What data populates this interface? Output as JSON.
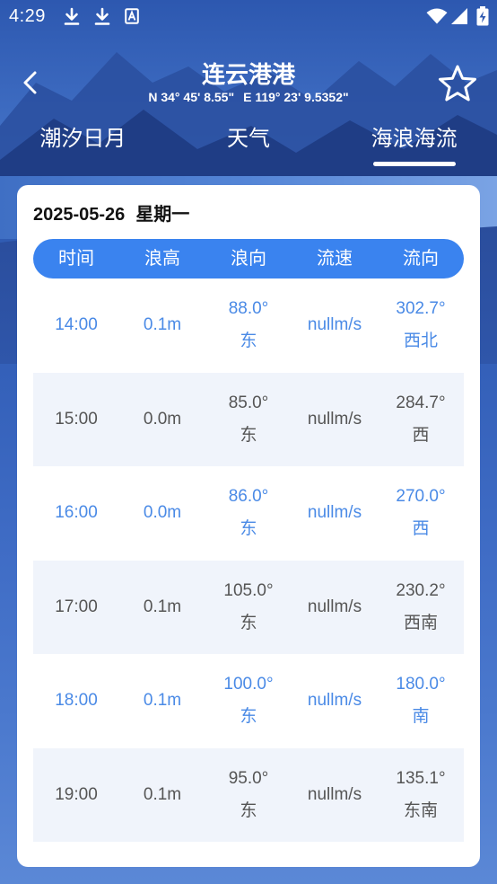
{
  "status_bar": {
    "time": "4:29",
    "left_icons": [
      "download-icon",
      "download-icon",
      "a-box-icon"
    ],
    "right_icons": [
      "wifi-icon",
      "signal-icon",
      "battery-charging-icon"
    ]
  },
  "header": {
    "back_icon": "chevron-left-icon",
    "title": "连云港港",
    "latitude": "N 34° 45' 8.55\"",
    "longitude": "E 119° 23' 9.5352\"",
    "favorite_icon": "star-outline-icon"
  },
  "tabs": [
    {
      "label": "潮汐日月",
      "active": false
    },
    {
      "label": "天气",
      "active": false
    },
    {
      "label": "海浪海流",
      "active": true
    }
  ],
  "card": {
    "date": "2025-05-26",
    "weekday": "星期一",
    "columns": [
      "时间",
      "浪高",
      "浪向",
      "流速",
      "流向"
    ],
    "rows": [
      {
        "time": "14:00",
        "wave_height": "0.1m",
        "wave_direction_deg": "88.0°",
        "wave_direction": "东",
        "current_speed": "nullm/s",
        "current_direction_deg": "302.7°",
        "current_direction": "西北"
      },
      {
        "time": "15:00",
        "wave_height": "0.0m",
        "wave_direction_deg": "85.0°",
        "wave_direction": "东",
        "current_speed": "nullm/s",
        "current_direction_deg": "284.7°",
        "current_direction": "西"
      },
      {
        "time": "16:00",
        "wave_height": "0.0m",
        "wave_direction_deg": "86.0°",
        "wave_direction": "东",
        "current_speed": "nullm/s",
        "current_direction_deg": "270.0°",
        "current_direction": "西"
      },
      {
        "time": "17:00",
        "wave_height": "0.1m",
        "wave_direction_deg": "105.0°",
        "wave_direction": "东",
        "current_speed": "nullm/s",
        "current_direction_deg": "230.2°",
        "current_direction": "西南"
      },
      {
        "time": "18:00",
        "wave_height": "0.1m",
        "wave_direction_deg": "100.0°",
        "wave_direction": "东",
        "current_speed": "nullm/s",
        "current_direction_deg": "180.0°",
        "current_direction": "南"
      },
      {
        "time": "19:00",
        "wave_height": "0.1m",
        "wave_direction_deg": "95.0°",
        "wave_direction": "东",
        "current_speed": "nullm/s",
        "current_direction_deg": "135.1°",
        "current_direction": "东南"
      }
    ]
  },
  "colors": {
    "accent": "#3a83ef",
    "highlight_text": "#4a8ae6",
    "normal_text": "#555555",
    "alt_row_bg": "#f0f4fb"
  }
}
